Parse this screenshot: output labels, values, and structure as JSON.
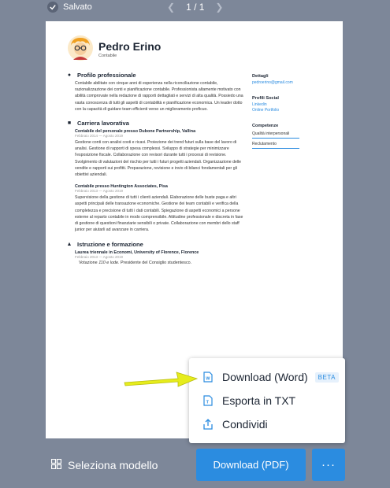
{
  "topbar": {
    "saved_label": "Salvato",
    "page_indicator": "1 / 1"
  },
  "resume": {
    "name": "Pedro Erino",
    "role": "Contabile",
    "profile": {
      "heading": "Profilo professionale",
      "text": "Contabile abilitato con cinque anni di esperienza nella riconciliazione contabile, razionalizzazione dei conti e pianificazione contabile. Professionista altamente motivato con abilità comprovate nella redazione di rapporti dettagliati e servizi di alta qualità. Possiedo una vasta conoscenza di tutti gli aspetti di contabilità e pianificazione economica. Un leader dotto con la capacità di guidare team efficienti verso un miglioramento proficuo."
    },
    "career": {
      "heading": "Carriera lavorativa",
      "jobs": [
        {
          "title": "Contabile del personale presso Dubone Partnership, Vallina",
          "dates": "Febbraio 2014 — Agosto 2019",
          "text": "Gestione conti con analisi costi e ricavi. Proiezione dei trend futuri sulla base del lavoro di analisi. Gestione di rapporti di spesa complessi. Sviluppo di strategie per minimizzare l'esposizione fiscale. Collaborazione con revisori durante tutti i processi di revisione. Svolgimento di valutazioni del rischio per tutti i futuri progetti aziendali. Organizzazione delle vendite e rapporti sui profitti. Preparazione, revisione e invio di bilanci fondamentali per gli obiettivi aziendali."
        },
        {
          "title": "Contabile presso Huntington Associates, Pisa",
          "dates": "Febbraio 2013 — Agosto 2019",
          "text": "Supervisione della gestione di tutti i clienti aziendali. Elaborazione delle buste paga e altri aspetti principali delle transazione economiche. Gestione dei team contabili e verifica della completezza e precisione di tutti i dati contabili. Spiegazione di aspetti economici a persone esterne al reparto contabile in modo comprensibile. Attitudine professionale e discreta in fase di gestione di questioni finanziarie sensibili o private. Collaborazione con membri dello staff junior per aiutarli ad avanzare in carriera."
        }
      ]
    },
    "education": {
      "heading": "Istruzione e formazione",
      "title": "Laurea triennale in Economi, University of Florence, Florence",
      "dates": "Febbraio 2013 — Agosto 2019",
      "text_prefix": "Votazione ",
      "text_grade": "110 e lode",
      "text_suffix": ". Presidente del Consiglio studentesco."
    },
    "side": {
      "details_heading": "Dettagli",
      "email": "pedroerino@gmail.com",
      "social_heading": "Profili Social",
      "linkedin": "Linkedin",
      "portfolio": "Online Portfolio",
      "skills_heading": "Competenze",
      "skills": [
        "Qualità interpersonali",
        "Reclutamento"
      ]
    }
  },
  "menu": {
    "items": [
      {
        "label": "Download (Word)",
        "badge": "BETA",
        "icon": "word-file-icon"
      },
      {
        "label": "Esporta in TXT",
        "icon": "text-file-icon"
      },
      {
        "label": "Condividi",
        "icon": "share-icon"
      }
    ]
  },
  "bottom": {
    "select_template": "Seleziona modello",
    "download_pdf": "Download (PDF)",
    "more": "···"
  },
  "colors": {
    "accent": "#2b8ce0",
    "background": "#7d8799",
    "arrow": "#e6ec1c"
  }
}
